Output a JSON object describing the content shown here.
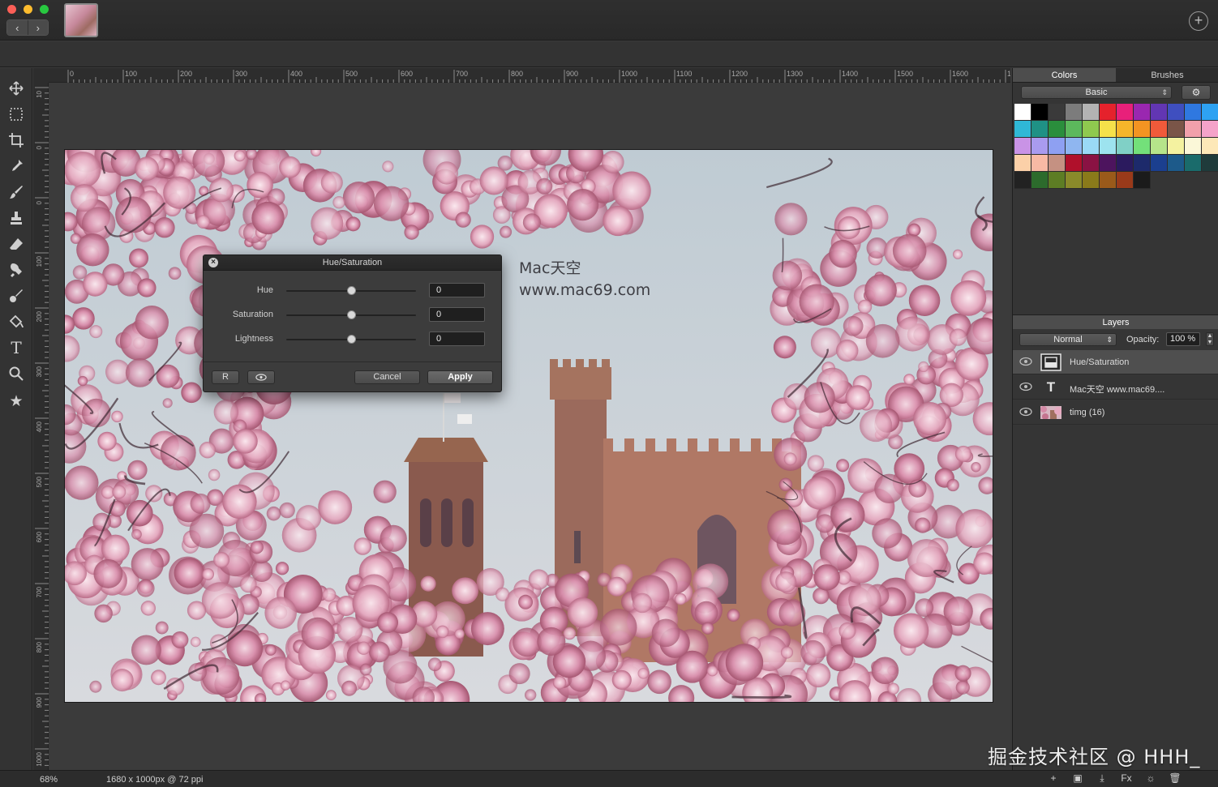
{
  "titlebar": {
    "back_icon": "chevron-left-icon",
    "forward_icon": "chevron-right-icon",
    "add_icon": "plus-circle-icon"
  },
  "toolbar": {
    "tools": [
      "move-icon",
      "marquee-icon",
      "crop-icon",
      "eyedropper-icon",
      "brush-icon",
      "stamp-icon",
      "eraser-icon",
      "smudge-icon",
      "pen-icon",
      "fill-icon",
      "text-icon",
      "zoom-icon",
      "star-icon"
    ]
  },
  "rulers": {
    "top_labels": [
      "0",
      "100",
      "200",
      "300",
      "400",
      "500",
      "600",
      "700",
      "800",
      "900",
      "1000",
      "1100",
      "1200",
      "1300",
      "1400",
      "1500",
      "1600",
      "1"
    ],
    "left_labels": [
      "10",
      "0",
      "0",
      "100",
      "200",
      "300",
      "400",
      "500",
      "600",
      "700",
      "800",
      "900",
      "1000",
      "1100"
    ]
  },
  "canvas": {
    "overlay_line1": "Mac天空",
    "overlay_line2": "www.mac69.com"
  },
  "dialog": {
    "title": "Hue/Saturation",
    "hue_label": "Hue",
    "hue_value": "0",
    "saturation_label": "Saturation",
    "saturation_value": "0",
    "lightness_label": "Lightness",
    "lightness_value": "0",
    "slider_level": 0.5,
    "reset_label": "R",
    "preview_icon": "eye-icon",
    "cancel_label": "Cancel",
    "apply_label": "Apply"
  },
  "colors_panel": {
    "tab_colors": "Colors",
    "tab_brushes": "Brushes",
    "preset": "Basic",
    "settings_icon": "gear-icon",
    "swatches": [
      "#ffffff",
      "#000000",
      "#3a3a3a",
      "#7c7c7c",
      "#b3b3b3",
      "#e5222c",
      "#e8207a",
      "#9a27b0",
      "#6236b3",
      "#3f4fbf",
      "#2f78e0",
      "#2ea2f2",
      "#2fb8d6",
      "#1f9185",
      "#2a8e3c",
      "#5cb85c",
      "#8fc94f",
      "#f5e14a",
      "#f5b52a",
      "#f39422",
      "#f05a3a",
      "#7a5548",
      "#f2a0ab",
      "#f5a3c9",
      "#c993e6",
      "#a99bef",
      "#8ea0f2",
      "#8fb6f0",
      "#9ad9f6",
      "#9de3ef",
      "#80d0c6",
      "#73e07a",
      "#b6e48a",
      "#f4f2a0",
      "#fbf7d8",
      "#fde8b8",
      "#fbd0a8",
      "#f8b9a4",
      "#c59182",
      "#b0102b",
      "#8a1243",
      "#4d145e",
      "#2b1a5e",
      "#1d2a6b",
      "#1b3f8f",
      "#1d5a8a",
      "#1a6b6b",
      "#1f3b3b",
      "#222222",
      "#2c6b2c",
      "#5d7d24",
      "#8a8a2a",
      "#8a7a1a",
      "#9a5a1a",
      "#9a3a1a",
      "#1b1b1b"
    ]
  },
  "layers_panel": {
    "title": "Layers",
    "blend_mode": "Normal",
    "opacity_label": "Opacity:",
    "opacity_value": "100 %",
    "layers": [
      {
        "name": "Hue/Saturation",
        "kind": "adjustment",
        "visible": true,
        "selected": true
      },
      {
        "name": "Mac天空 www.mac69....",
        "kind": "text",
        "visible": true,
        "selected": false
      },
      {
        "name": "timg (16)",
        "kind": "image",
        "visible": true,
        "selected": false
      }
    ],
    "footer_icons": [
      "plus-icon",
      "new-layer-icon",
      "download-icon",
      "fx-icon",
      "sun-icon",
      "trash-icon"
    ],
    "fx_label": "Fx"
  },
  "statusbar": {
    "zoom": "68%",
    "document_size": "1680 x 1000px @ 72 ppi"
  },
  "watermark": {
    "text": "掘金技术社区 @ HHH_"
  }
}
